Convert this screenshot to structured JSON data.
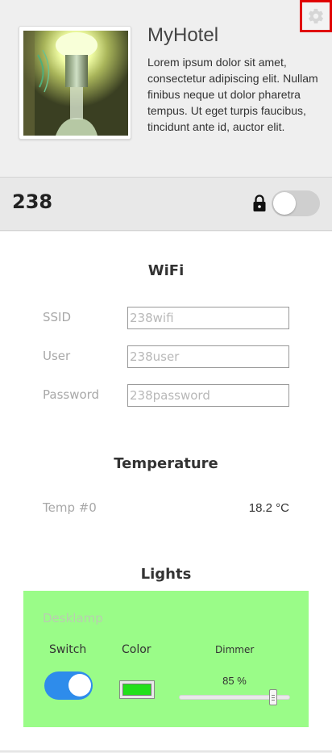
{
  "header": {
    "hotel_name": "MyHotel",
    "description": "Lorem ipsum dolor sit amet, consectetur adipiscing elit. Nullam finibus neque ut dolor pharetra tempus. Ut eget turpis faucibus, tincidunt ante id, auctor elit.",
    "settings_icon": "gear-icon",
    "photo_icon": "light-bulb-photo"
  },
  "room": {
    "number": "238",
    "lock_icon": "lock-icon",
    "lock_toggle_on": false
  },
  "wifi": {
    "title": "WiFi",
    "fields": [
      {
        "label": "SSID",
        "value": "238wifi"
      },
      {
        "label": "User",
        "value": "238user"
      },
      {
        "label": "Password",
        "value": "238password"
      }
    ]
  },
  "temperature": {
    "title": "Temperature",
    "sensors": [
      {
        "label": "Temp #0",
        "value": "18.2 °C"
      }
    ]
  },
  "lights": {
    "title": "Lights",
    "panel_color": "#9afc88",
    "items": [
      {
        "name": "Desklamp",
        "switch_label": "Switch",
        "color_label": "Color",
        "dimmer_label": "Dimmer",
        "switch_on": true,
        "color": "#22e01a",
        "dimmer_text": "85 %",
        "dimmer_value": 0.85
      }
    ]
  },
  "colors": {
    "highlight_border": "#e00000",
    "switch_on": "#2e8ceb",
    "toggle_off": "#cfcfcf"
  }
}
